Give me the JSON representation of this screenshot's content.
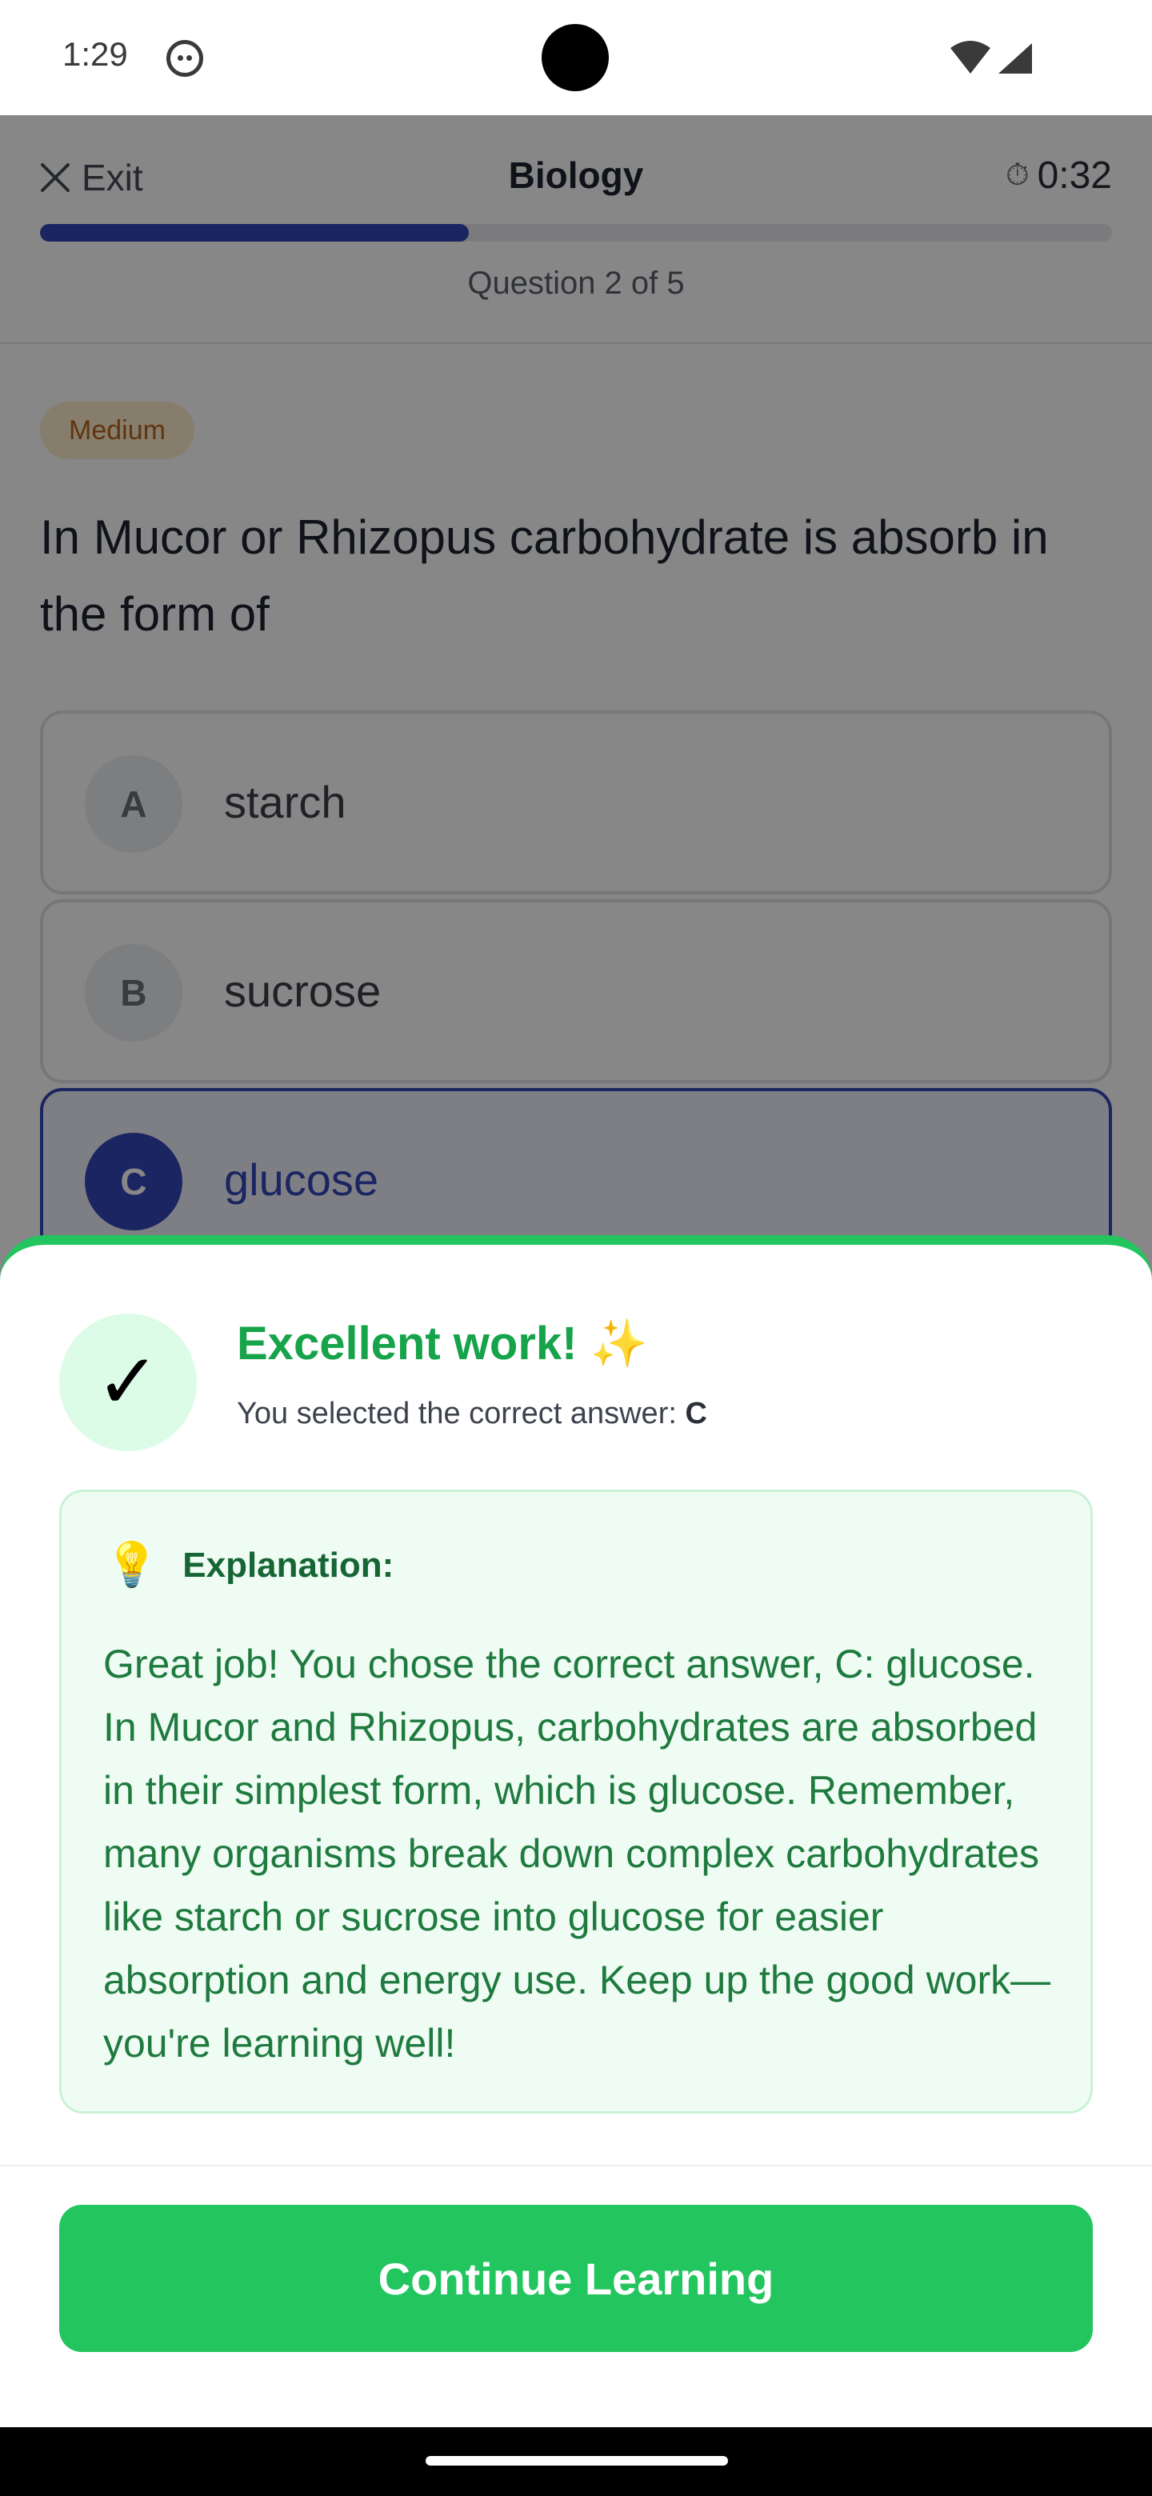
{
  "status_bar": {
    "time": "1:29"
  },
  "header": {
    "exit_label": "Exit",
    "title": "Biology",
    "timer": "0:32",
    "progress_fraction": 0.4,
    "question_counter": "Question 2 of 5"
  },
  "question": {
    "difficulty": "Medium",
    "text": "In Mucor or Rhizopus carbohydrate is absorb in the form of",
    "options": [
      {
        "letter": "A",
        "text": "starch",
        "selected": false
      },
      {
        "letter": "B",
        "text": "sucrose",
        "selected": false
      },
      {
        "letter": "C",
        "text": "glucose",
        "selected": true
      }
    ]
  },
  "feedback": {
    "title": "Excellent work!",
    "title_emoji": "✨",
    "check_glyph": "✓",
    "subtitle_prefix": "You selected the correct answer: ",
    "selected_answer": "C",
    "explanation_icon": "💡",
    "explanation_label": "Explanation:",
    "explanation_text": "Great job! You chose the correct answer, C: glucose. In Mucor and Rhizopus, carbohydrates are absorbed in their simplest form, which is glucose. Remember, many organisms break down complex carbohydrates like starch or sucrose into glucose for easier absorption and energy use. Keep up the good work—you're learning well!",
    "continue_label": "Continue Learning"
  },
  "colors": {
    "brand_blue": "#3447b8",
    "success_green": "#22c55e",
    "success_text": "#16a34a"
  },
  "icons": {
    "close": "close-icon",
    "timer": "stopwatch-icon",
    "success": "check-icon",
    "bulb": "lightbulb-icon",
    "sparkle": "sparkle-icon"
  }
}
